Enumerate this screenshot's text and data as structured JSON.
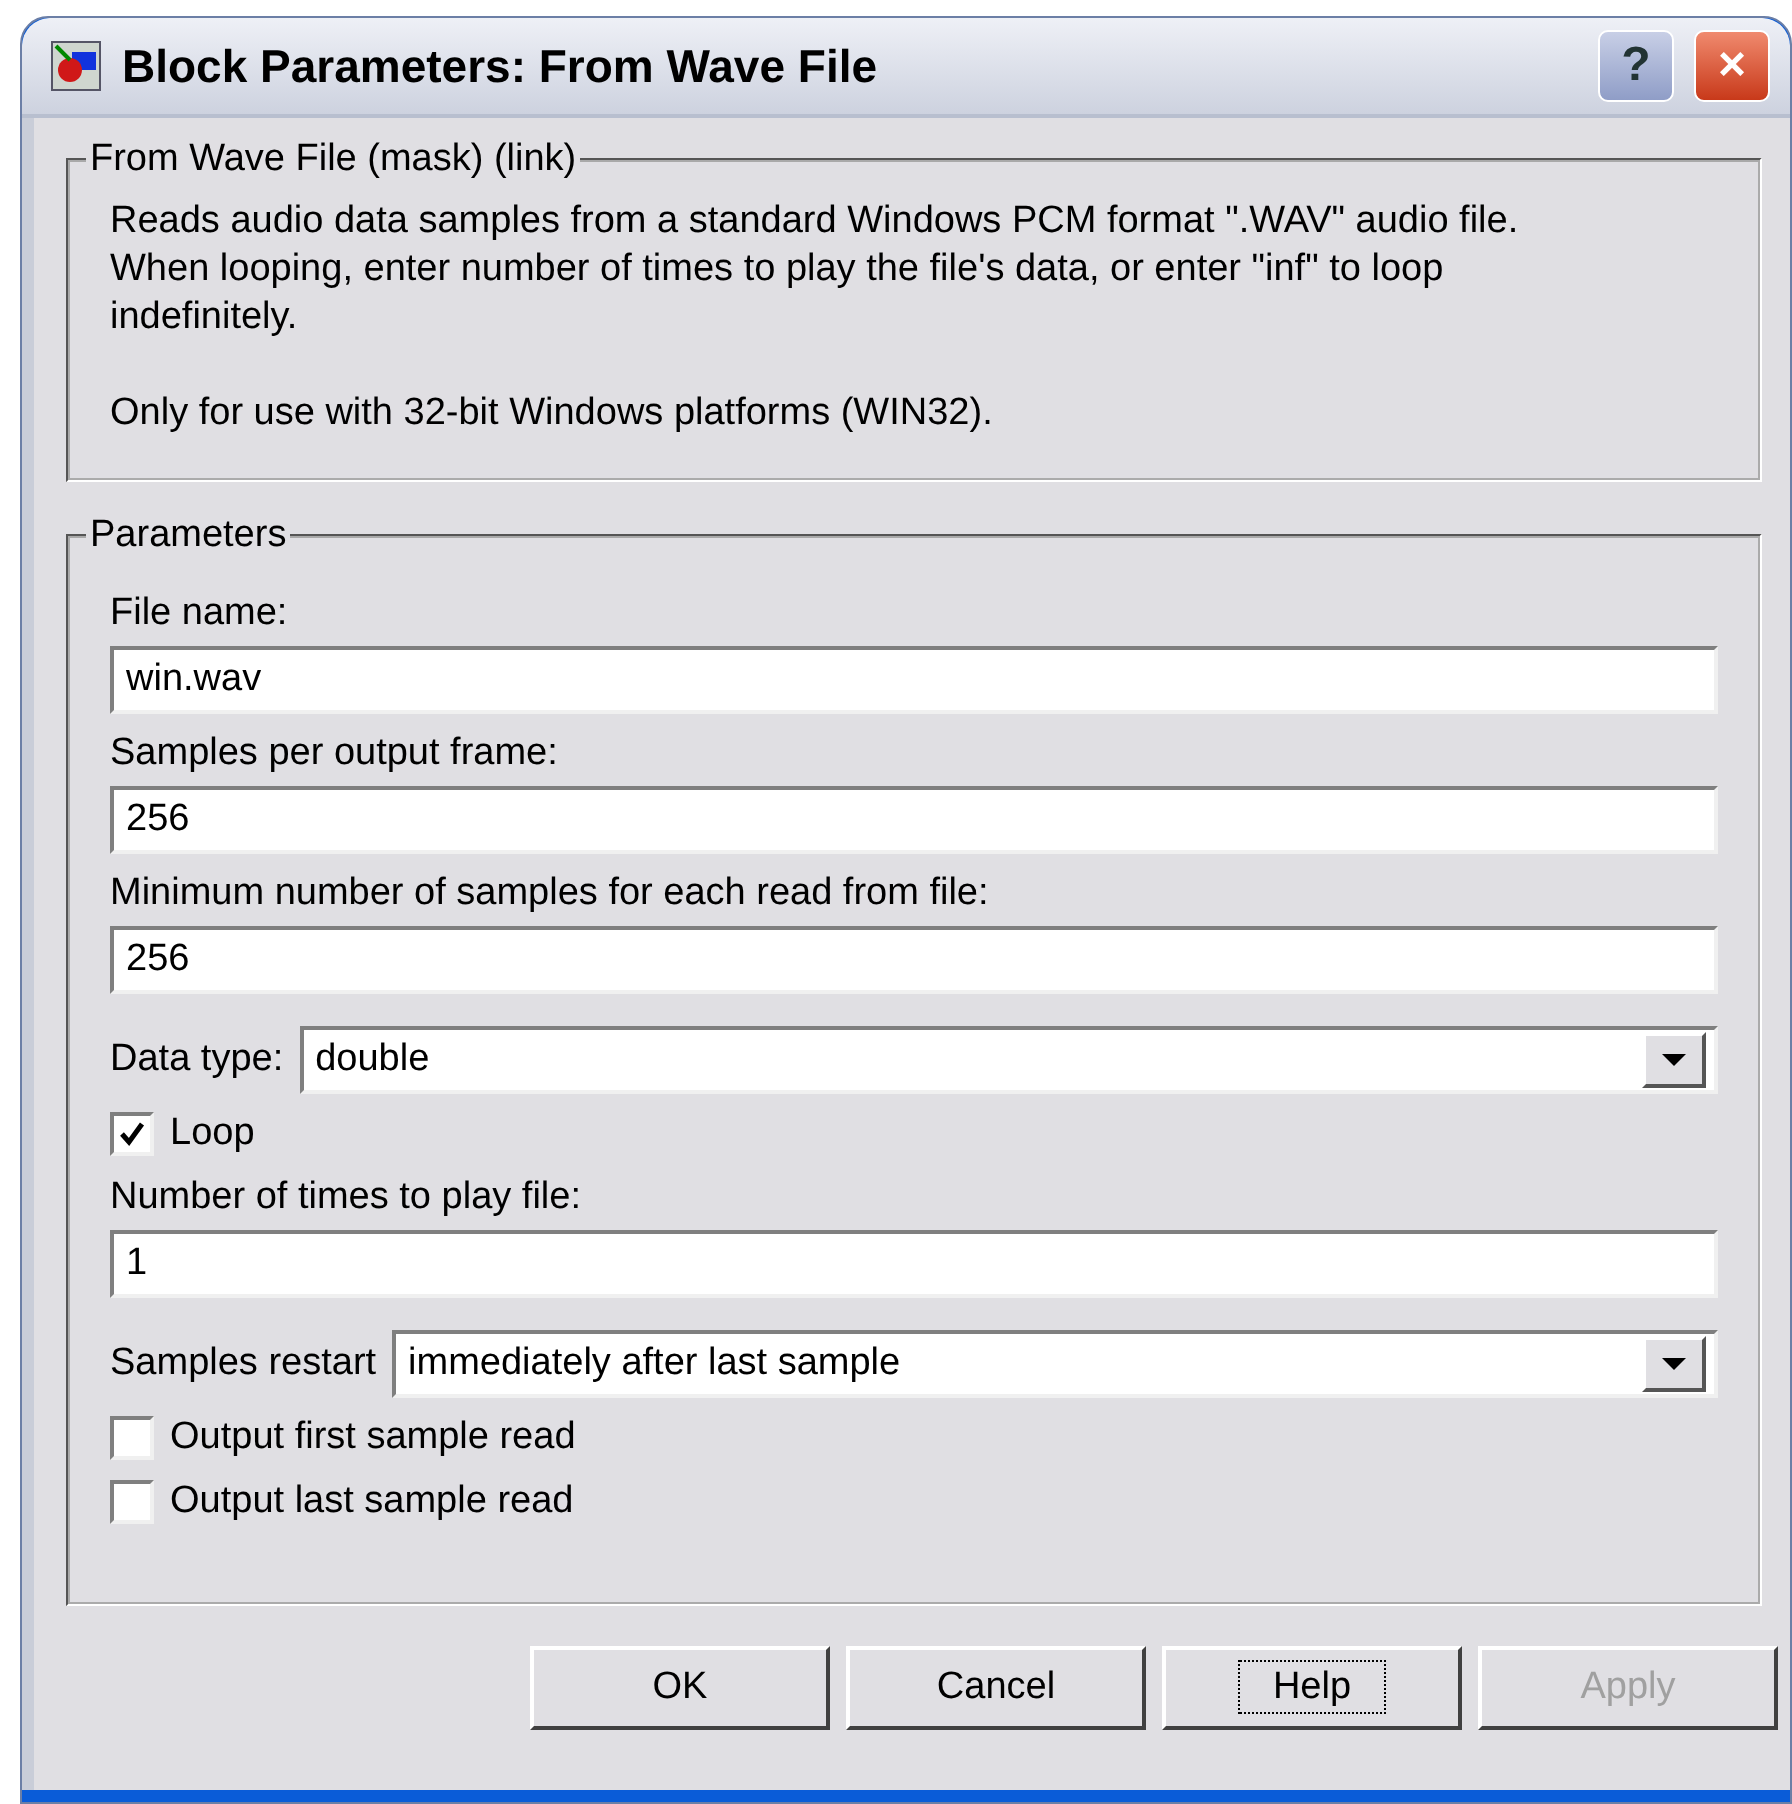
{
  "window": {
    "title": "Block Parameters: From Wave File",
    "title_buttons": [
      "?",
      "×"
    ]
  },
  "description": {
    "legend": "From Wave File (mask) (link)",
    "paragraphs": [
      {
        "lines": [
          "Reads audio data samples from a standard Windows PCM format \".WAV\" audio file.",
          "When looping, enter number of times to play the file's data, or enter \"inf\" to loop",
          "indefinitely."
        ]
      },
      {
        "lines": [
          "Only for use with 32-bit Windows platforms (WIN32)."
        ]
      }
    ]
  },
  "parameters": {
    "legend": "Parameters",
    "controls": [
      {
        "kind": "text",
        "label": "File name:",
        "value": "win.wav"
      },
      {
        "kind": "text",
        "label": "Samples per output frame:",
        "value": "256"
      },
      {
        "kind": "text",
        "label": "Minimum number of samples for each read from file:",
        "value": "256"
      },
      {
        "kind": "select",
        "label": "Data type:",
        "value": "double"
      },
      {
        "kind": "checkbox",
        "label": "Loop",
        "checked": true
      },
      {
        "kind": "text",
        "label": "Number of times to play file:",
        "value": "1"
      },
      {
        "kind": "select",
        "label": "Samples restart",
        "value": "immediately after last sample"
      },
      {
        "kind": "checkbox",
        "label": "Output first sample read",
        "checked": false
      },
      {
        "kind": "checkbox",
        "label": "Output last sample read",
        "checked": false
      }
    ]
  },
  "buttons": [
    {
      "label": "OK",
      "focused": false,
      "disabled": false
    },
    {
      "label": "Cancel",
      "focused": false,
      "disabled": false
    },
    {
      "label": "Help",
      "focused": true,
      "disabled": false
    },
    {
      "label": "Apply",
      "focused": false,
      "disabled": true
    }
  ]
}
